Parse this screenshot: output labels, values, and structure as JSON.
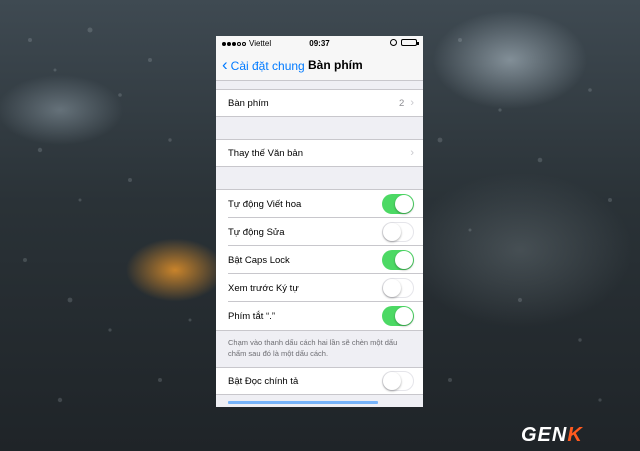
{
  "status_bar": {
    "carrier": "Viettel",
    "time": "09:37"
  },
  "nav": {
    "back_label": "Cài đặt chung",
    "title": "Bàn phím"
  },
  "keyboards_row": {
    "label": "Bàn phím",
    "detail": "2"
  },
  "text_replacement_row": {
    "label": "Thay thế Văn bản"
  },
  "toggles": [
    {
      "label": "Tự động Viết hoa",
      "on": true
    },
    {
      "label": "Tự động Sửa",
      "on": false
    },
    {
      "label": "Bật Caps Lock",
      "on": true
    },
    {
      "label": "Xem trước Ký tự",
      "on": false
    },
    {
      "label": "Phím tắt “.”",
      "on": true
    }
  ],
  "footnote": "Chạm vào thanh dấu cách hai lần sẽ chèn một dấu chấm sau đó là một dấu cách.",
  "spell_check_row": {
    "label": "Bật Đọc chính tả",
    "on": false
  },
  "watermark": {
    "text_main": "GEN",
    "text_accent": "K"
  },
  "colors": {
    "accent": "#007aff",
    "toggle_on": "#4cd964",
    "logo_accent": "#ff5a1f"
  }
}
